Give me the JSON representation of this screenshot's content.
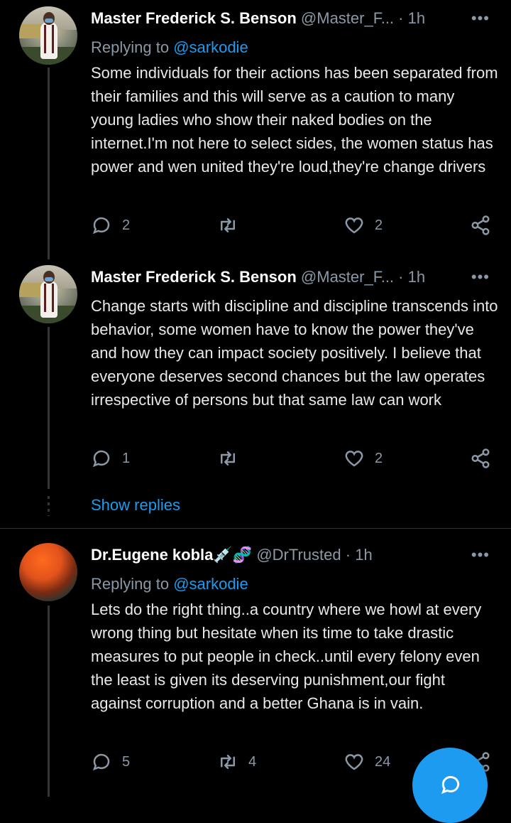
{
  "tweets": [
    {
      "name": "Master Frederick S. Benson",
      "handle": "@Master_F...",
      "time": "1h",
      "replying_prefix": "Replying to ",
      "replying_to": "@sarkodie",
      "text": "Some individuals for their actions has been separated from their families and this will serve as a caution to many young ladies who show their naked bodies on the internet.I'm not here to select sides, the women status has power and wen united they're loud,they're change drivers",
      "replies": "2",
      "retweets": "",
      "likes": "2"
    },
    {
      "name": "Master Frederick S. Benson",
      "handle": "@Master_F...",
      "time": "1h",
      "text": "Change starts with discipline and discipline transcends into behavior, some women have to know the power they've and how they can impact society positively. I believe that everyone deserves second chances but the law operates irrespective of persons but that same law can work",
      "replies": "1",
      "retweets": "",
      "likes": "2"
    },
    {
      "name": "Dr.Eugene kobla",
      "name_emoji": "💉🧬",
      "handle": "@DrTrusted",
      "time": "1h",
      "replying_prefix": "Replying to ",
      "replying_to": "@sarkodie",
      "text": "Lets do the right thing..a country where we howl at every wrong thing but hesitate when its time to take drastic measures to put people in check..until every felony  even the least is given its deserving punishment,our fight against corruption and a better Ghana is in vain.",
      "replies": "5",
      "retweets": "4",
      "likes": "24"
    }
  ],
  "show_replies": "Show replies",
  "more_glyph": "•••",
  "separator": "·",
  "icons": [
    "reply-icon",
    "retweet-icon",
    "like-icon",
    "share-icon",
    "compose-reply-icon"
  ],
  "colors": {
    "accent": "#1d9bf0",
    "muted": "#8b98a5",
    "background": "#000000"
  }
}
